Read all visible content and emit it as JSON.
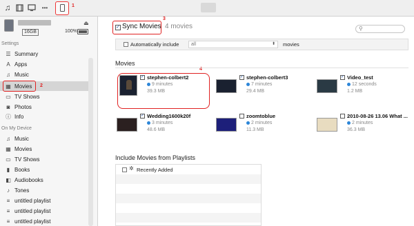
{
  "toolbar": {
    "icons": [
      "music-icon",
      "film-icon",
      "tv-icon",
      "more-icon"
    ],
    "more_label": "•••",
    "step1": "1"
  },
  "sidebar": {
    "capacity": "16GB",
    "battery_pct": "100%",
    "settings_header": "Settings",
    "settings_items": [
      {
        "label": "Summary",
        "icon": "summary-icon"
      },
      {
        "label": "Apps",
        "icon": "apps-icon"
      },
      {
        "label": "Music",
        "icon": "music-icon"
      },
      {
        "label": "Movies",
        "icon": "movies-icon",
        "selected": true
      },
      {
        "label": "TV Shows",
        "icon": "tv-icon"
      },
      {
        "label": "Photos",
        "icon": "photos-icon"
      },
      {
        "label": "Info",
        "icon": "info-icon"
      }
    ],
    "step2": "2",
    "device_header": "On My Device",
    "device_items": [
      {
        "label": "Music",
        "icon": "music-icon"
      },
      {
        "label": "Movies",
        "icon": "film-icon"
      },
      {
        "label": "TV Shows",
        "icon": "tv-icon"
      },
      {
        "label": "Books",
        "icon": "books-icon"
      },
      {
        "label": "Audiobooks",
        "icon": "audiobooks-icon"
      },
      {
        "label": "Tones",
        "icon": "bell-icon"
      },
      {
        "label": "untitled playlist",
        "icon": "playlist-icon"
      },
      {
        "label": "untitled playlist",
        "icon": "playlist-icon"
      },
      {
        "label": "untitled playlist",
        "icon": "playlist-icon"
      }
    ]
  },
  "main": {
    "sync_label": "Sync Movies",
    "sync_count": "4 movies",
    "step3": "3",
    "auto_include_label": "Automatically include",
    "auto_select_value": "all",
    "auto_suffix": "movies",
    "movies_header": "Movies",
    "step4": "4",
    "movies": [
      {
        "title": "stephen-colbert2",
        "duration": "9 minutes",
        "size": "39.3 MB",
        "checked": true
      },
      {
        "title": "stephen-colbert3",
        "duration": "7 minutes",
        "size": "29.4 MB",
        "checked": true
      },
      {
        "title": "Video_test",
        "duration": "12 seconds",
        "size": "1.2 MB",
        "checked": true
      },
      {
        "title": "Wedding1600k20f",
        "duration": "3 minutes",
        "size": "48.6 MB",
        "checked": true
      },
      {
        "title": "zoomtoblue",
        "duration": "2 minutes",
        "size": "11.3 MB",
        "checked": false
      },
      {
        "title": "2010-08-26  13.06  What ...",
        "duration": "2 minutes",
        "size": "36.3 MB",
        "checked": false
      }
    ],
    "playlists_header": "Include Movies from Playlists",
    "playlists": [
      {
        "label": "Recently Added"
      }
    ]
  },
  "colors": {
    "annotation": "#e02020",
    "accent": "#2d86d8"
  }
}
